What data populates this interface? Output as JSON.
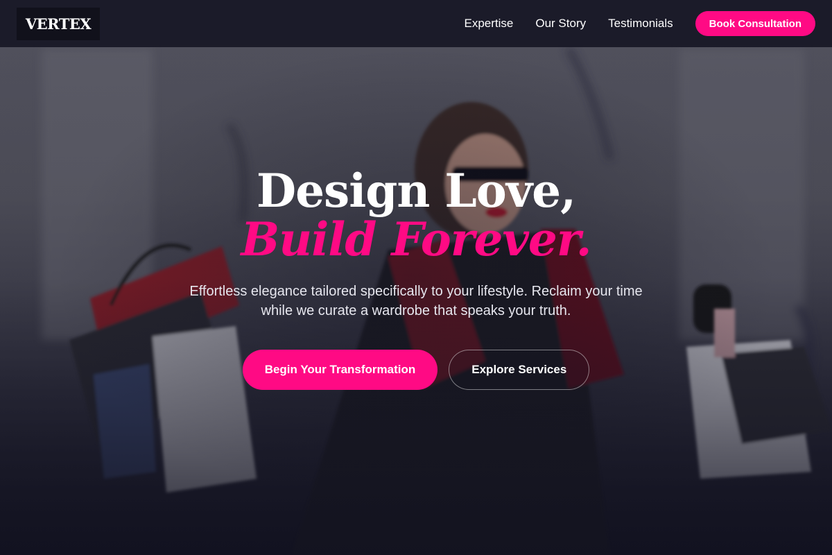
{
  "brand": {
    "logo_text": "VERTEX"
  },
  "nav": {
    "links": [
      "Expertise",
      "Our Story",
      "Testimonials"
    ],
    "cta_label": "Book Consultation"
  },
  "hero": {
    "headline_line1": "Design Love,",
    "headline_line2": "Build Forever.",
    "subtitle": "Effortless elegance tailored specifically to your lifestyle. Reclaim your time while we curate a wardrobe that speaks your truth.",
    "primary_cta": "Begin Your Transformation",
    "secondary_cta": "Explore Services"
  },
  "colors": {
    "accent": "#ff0a84",
    "nav_background": "#1b1b29",
    "logo_background": "#11111b",
    "dark_base": "#141421"
  }
}
